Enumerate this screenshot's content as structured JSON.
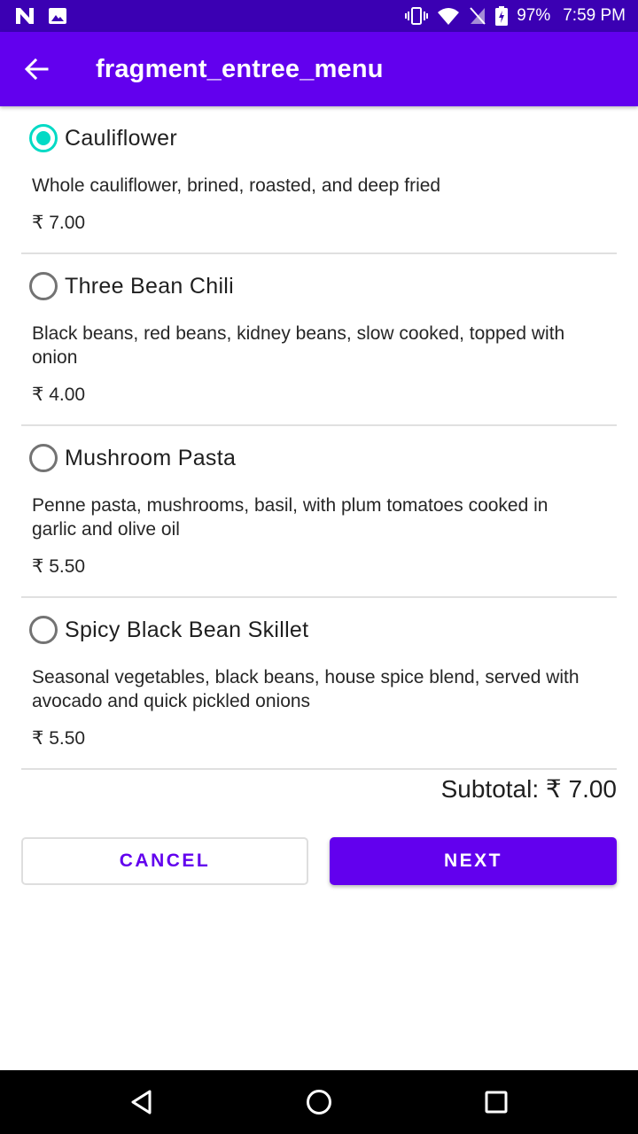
{
  "status_bar": {
    "battery": "97%",
    "time": "7:59 PM"
  },
  "app_bar": {
    "title": "fragment_entree_menu"
  },
  "menu": {
    "items": [
      {
        "name": "Cauliflower",
        "description": "Whole cauliflower, brined, roasted, and deep fried",
        "price": "₹ 7.00",
        "selected": true
      },
      {
        "name": "Three Bean Chili",
        "description": "Black beans, red beans, kidney beans, slow cooked, topped with onion",
        "price": "₹ 4.00",
        "selected": false
      },
      {
        "name": "Mushroom Pasta",
        "description": "Penne pasta, mushrooms, basil, with plum tomatoes cooked in garlic and olive oil",
        "price": "₹ 5.50",
        "selected": false
      },
      {
        "name": "Spicy Black Bean Skillet",
        "description": "Seasonal vegetables, black beans, house spice blend, served with avocado and quick pickled onions",
        "price": "₹ 5.50",
        "selected": false
      }
    ]
  },
  "subtotal": "Subtotal: ₹ 7.00",
  "buttons": {
    "cancel": "CANCEL",
    "next": "NEXT"
  },
  "colors": {
    "status_bar": "#3b00b3",
    "app_bar": "#6200ee",
    "radio_selected": "#03dac5",
    "primary": "#6200ee"
  },
  "icons": {
    "status_left": [
      "n-notification-icon",
      "image-notification-icon"
    ],
    "status_right": [
      "vibrate-icon",
      "wifi-icon",
      "no-sim-icon",
      "battery-charging-icon"
    ],
    "nav": [
      "back-triangle-icon",
      "home-circle-icon",
      "recents-square-icon"
    ]
  }
}
